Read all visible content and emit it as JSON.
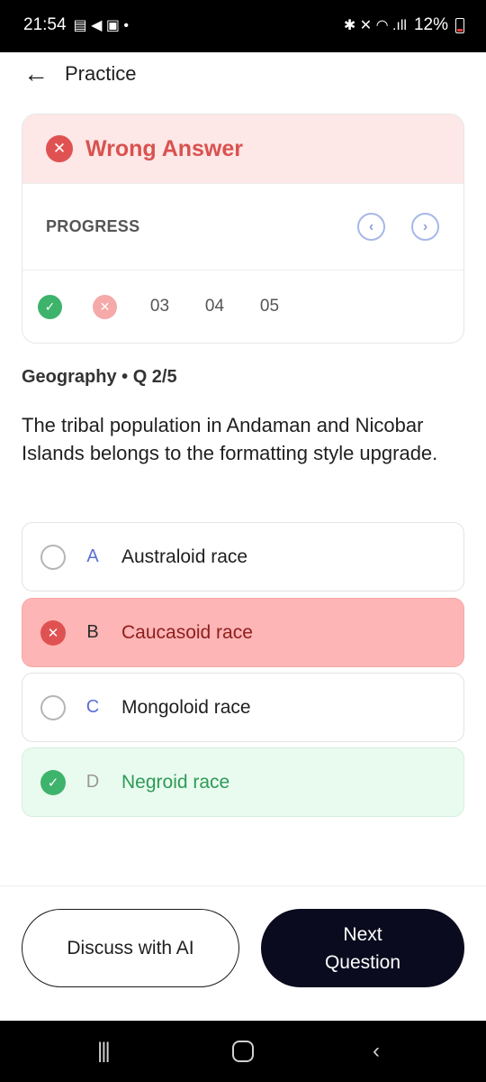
{
  "status_bar": {
    "time": "21:54",
    "battery": "12%"
  },
  "header": {
    "title": "Practice"
  },
  "result": {
    "label": "Wrong Answer"
  },
  "progress": {
    "label": "PROGRESS",
    "items": [
      "03",
      "04",
      "05"
    ]
  },
  "question": {
    "meta": "Geography • Q 2/5",
    "text": "The tribal population in Andaman and Nicobar Islands belongs to the formatting style upgrade."
  },
  "options": [
    {
      "letter": "A",
      "text": "Australoid race",
      "state": "unselected"
    },
    {
      "letter": "B",
      "text": "Caucasoid race",
      "state": "wrong"
    },
    {
      "letter": "C",
      "text": "Mongoloid race",
      "state": "unselected"
    },
    {
      "letter": "D",
      "text": "Negroid race",
      "state": "correct"
    }
  ],
  "actions": {
    "discuss": "Discuss with AI",
    "next": "Next Question"
  },
  "colors": {
    "wrong": "#d9524f",
    "correct": "#3db36b",
    "primary_button": "#0b0b1f"
  }
}
